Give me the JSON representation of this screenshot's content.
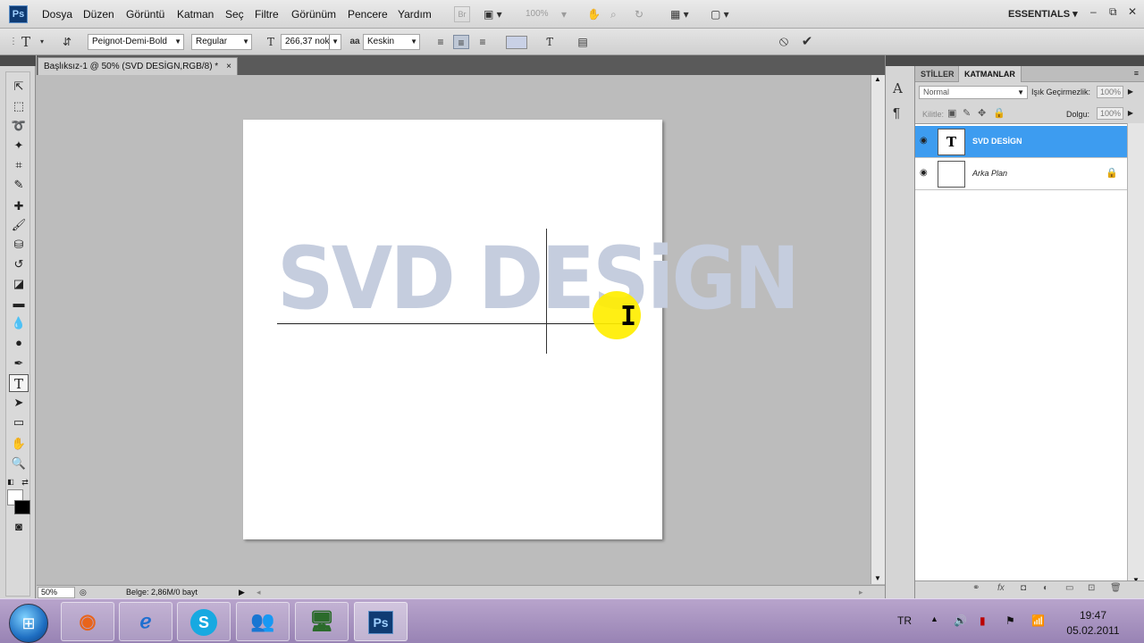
{
  "menubar": {
    "logo": "Ps",
    "items": [
      "Dosya",
      "Düzen",
      "Görüntü",
      "Katman",
      "Seç",
      "Filtre",
      "Görünüm",
      "Pencere",
      "Yardım"
    ],
    "bridge_label": "Br",
    "zoom": "100%",
    "workspace": "ESSENTIALS",
    "window_minimize": "–",
    "window_restore": "⧉",
    "window_close": "✕"
  },
  "options": {
    "tool_glyph": "T",
    "font_family": "Peignot-Demi-Bold",
    "font_style": "Regular",
    "font_size": "266,37 nok",
    "antialias_icon": "aa",
    "antialias": "Keskin",
    "text_color": "#c9d1e6",
    "cancel_icon": "⦸",
    "commit_icon": "✔"
  },
  "document_tab": {
    "title": "Başlıksız-1 @ 50% (SVD DESİGN,RGB/8) *",
    "close": "×"
  },
  "canvas": {
    "text": "SVD DESiGN",
    "text_color": "#c5cdde"
  },
  "status": {
    "zoom": "50%",
    "doc_info": "Belge: 2,86M/0 bayt"
  },
  "panel": {
    "tabs": [
      "STİLLER",
      "KATMANLAR"
    ],
    "blend_mode": "Normal",
    "opacity_label": "Işık Geçirmezlik:",
    "opacity": "100%",
    "lock_label": "Kilitle:",
    "fill_label": "Dolgu:",
    "fill": "100%",
    "layers": [
      {
        "name": "SVD DESİGN",
        "type": "text",
        "thumb": "T",
        "visible": true,
        "selected": true
      },
      {
        "name": "Arka Plan",
        "type": "background",
        "thumb": "",
        "visible": true,
        "selected": false
      }
    ]
  },
  "taskbar": {
    "start_icon": "⊞",
    "language": "TR",
    "time": "19:47",
    "date": "05.02.2011"
  }
}
